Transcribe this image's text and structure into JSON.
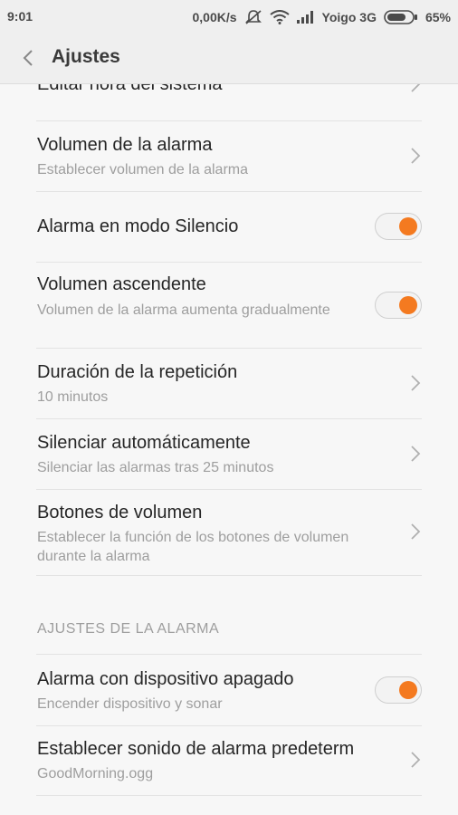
{
  "status_bar": {
    "time": "9:01",
    "speed": "0,00K/s",
    "carrier": "Yoigo 3G",
    "battery": "65%"
  },
  "header": {
    "title": "Ajustes"
  },
  "rows": [
    {
      "title": "Editar hora del sistema"
    },
    {
      "title": "Volumen de la alarma",
      "subtitle": "Establecer volumen de la alarma"
    },
    {
      "title": "Alarma en modo Silencio",
      "toggle": true
    },
    {
      "title": "Volumen ascendente",
      "subtitle": "Volumen de la alarma aumenta gradualmente",
      "toggle": true
    },
    {
      "title": "Duración de la repetición",
      "subtitle": "10 minutos"
    },
    {
      "title": "Silenciar automáticamente",
      "subtitle": "Silenciar las alarmas tras 25 minutos"
    },
    {
      "title": "Botones de volumen",
      "subtitle": "Establecer la función de los botones de volumen durante la alarma"
    }
  ],
  "section_header": "AJUSTES DE LA ALARMA",
  "section_rows": [
    {
      "title": "Alarma con dispositivo apagado",
      "subtitle": "Encender dispositivo y sonar",
      "toggle": true
    },
    {
      "title": "Establecer sonido de alarma predeterm",
      "subtitle": "GoodMorning.ogg"
    }
  ],
  "colors": {
    "accent": "#f47a20",
    "background": "#f7f7f7"
  }
}
